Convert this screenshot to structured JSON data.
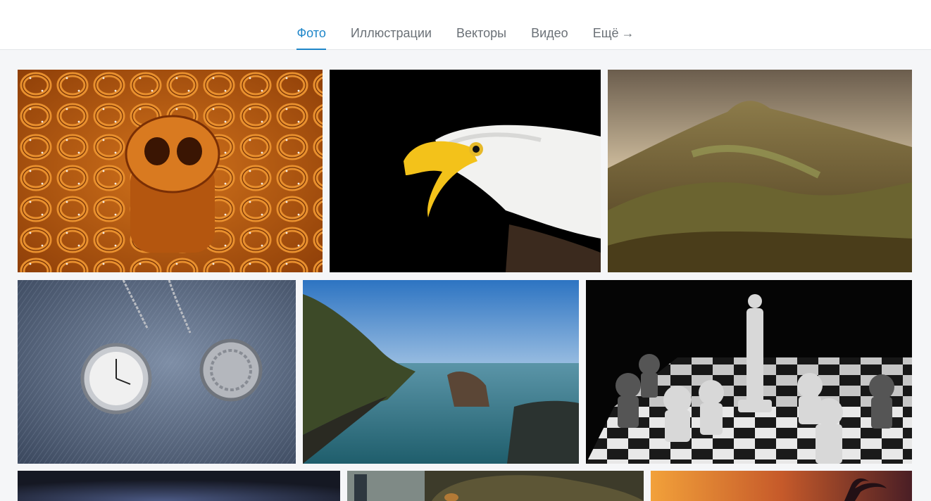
{
  "nav": {
    "tabs": [
      {
        "label": "Фото",
        "active": true
      },
      {
        "label": "Иллюстрации",
        "active": false
      },
      {
        "label": "Векторы",
        "active": false
      },
      {
        "label": "Видео",
        "active": false
      },
      {
        "label": "Ещё",
        "active": false,
        "icon": "arrow-right-icon",
        "arrow": "→"
      }
    ]
  },
  "colors": {
    "accent": "#1e86c9",
    "tab_text": "#6b7177",
    "background": "#f5f6f8"
  },
  "gallery": {
    "rows": [
      [
        "pretzels",
        "bald-eagle",
        "mountain-hills"
      ],
      [
        "pocket-watches",
        "sea-cliffs",
        "chess-pieces"
      ],
      [
        "dark-blue-gradient",
        "owl-partial",
        "sunset-palm"
      ]
    ]
  }
}
